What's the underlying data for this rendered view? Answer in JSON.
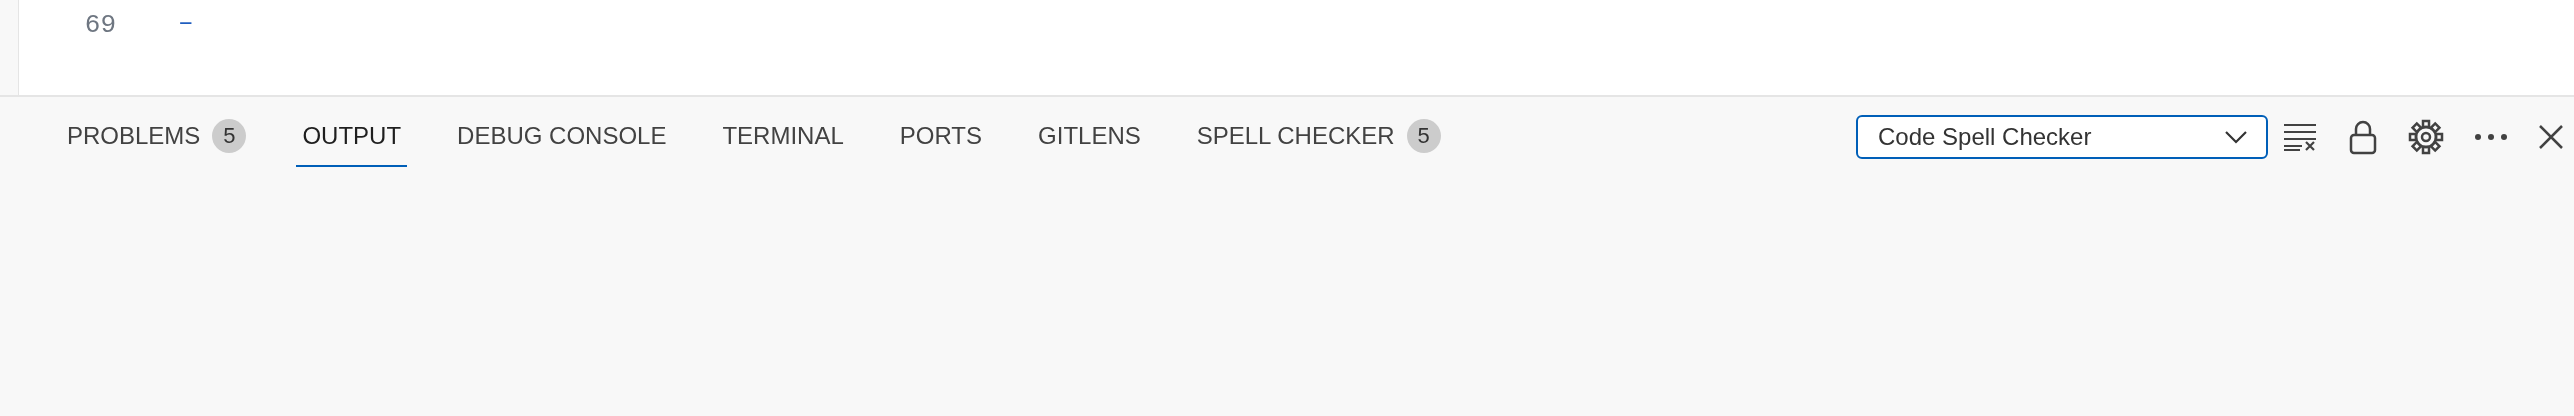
{
  "editor": {
    "line_number": "69",
    "line_text": "–"
  },
  "panel": {
    "tabs": [
      {
        "label": "PROBLEMS",
        "selected": false,
        "badge": "5"
      },
      {
        "label": "OUTPUT",
        "selected": true
      },
      {
        "label": "DEBUG CONSOLE",
        "selected": false
      },
      {
        "label": "TERMINAL",
        "selected": false
      },
      {
        "label": "PORTS",
        "selected": false
      },
      {
        "label": "GITLENS",
        "selected": false
      },
      {
        "label": "SPELL CHECKER",
        "selected": false,
        "badge": "5"
      }
    ],
    "channel_select": {
      "value": "Code Spell Checker"
    }
  }
}
